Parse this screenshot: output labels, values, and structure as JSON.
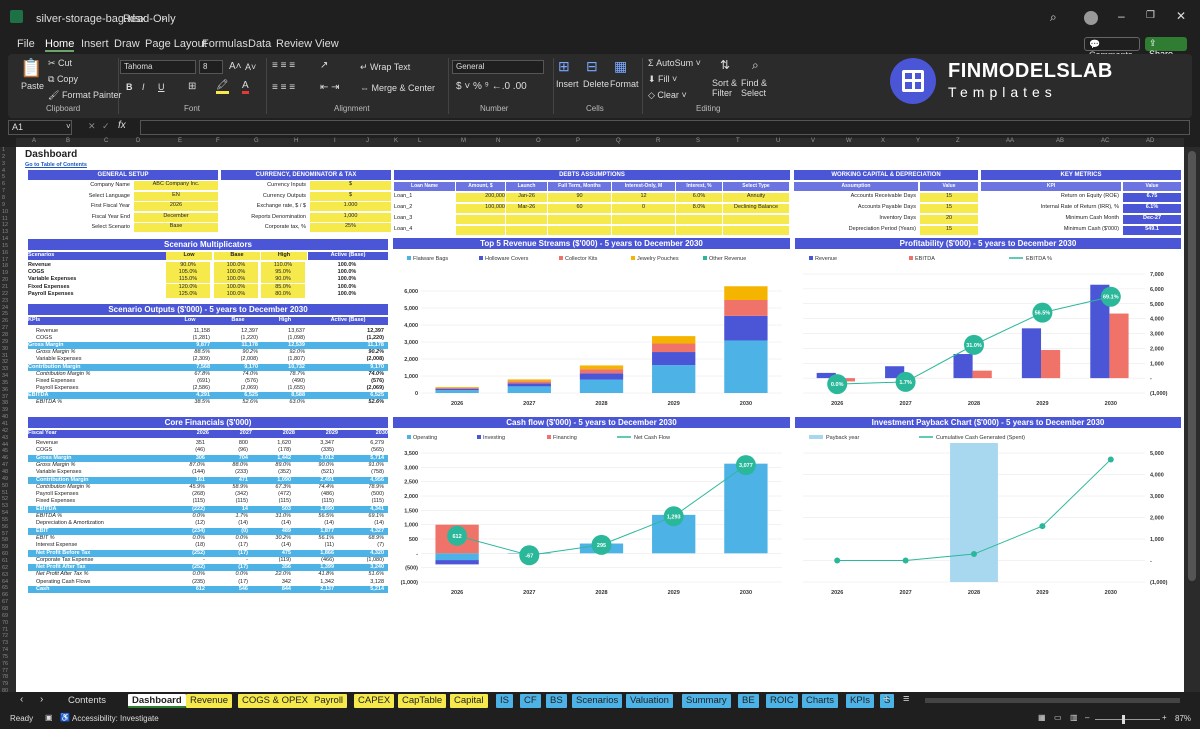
{
  "window": {
    "filename": "silver-storage-bag.xlsx",
    "mode": "Read-Only"
  },
  "menu": [
    "File",
    "Home",
    "Insert",
    "Draw",
    "Page Layout",
    "Formulas",
    "Data",
    "Review",
    "View"
  ],
  "comments_label": "Comments",
  "share_label": "Share",
  "ribbon": {
    "paste": "Paste",
    "cut": "Cut",
    "copy": "Copy",
    "format_painter": "Format Painter",
    "clipboard": "Clipboard",
    "font_name": "Tahoma",
    "font_size": "8",
    "font": "Font",
    "wrap_text": "Wrap Text",
    "merge_center": "Merge & Center",
    "alignment": "Alignment",
    "number_format": "General",
    "number": "Number",
    "insert": "Insert",
    "delete": "Delete",
    "format": "Format",
    "cells": "Cells",
    "autosum": "AutoSum",
    "fill": "Fill",
    "clear": "Clear",
    "sort_filter": "Sort & Filter",
    "find_select": "Find & Select",
    "editing": "Editing",
    "logo_top": "FINMODELSLAB",
    "logo_bottom": "Templates"
  },
  "namebox": "A1",
  "columns": [
    "A",
    "B",
    "C",
    "D",
    "E",
    "F",
    "G",
    "H",
    "I",
    "J",
    "K",
    "L",
    "M",
    "N",
    "O",
    "P",
    "Q",
    "R",
    "S",
    "T",
    "U",
    "V",
    "W",
    "X",
    "Y",
    "Z",
    "AA",
    "AB",
    "AC",
    "AD"
  ],
  "sheet": {
    "title": "Dashboard",
    "toc": "Go to Table of Contents",
    "general": {
      "header": "GENERAL SETUP",
      "rows": [
        [
          "Company Name",
          "ABC Company Inc."
        ],
        [
          "Select Language",
          "EN"
        ],
        [
          "First Fiscal Year",
          "2026"
        ],
        [
          "Fiscal Year End",
          "December"
        ],
        [
          "Select Scenario",
          "Base"
        ]
      ]
    },
    "currency": {
      "header": "CURRENCY, DENOMINATOR & TAX",
      "rows": [
        [
          "Currency Inputs",
          "$"
        ],
        [
          "Currency Outputs",
          "$"
        ],
        [
          "Exchange rate, $ / $",
          "1.000"
        ],
        [
          "Reports Denomination",
          "1,000"
        ],
        [
          "Corporate tax, %",
          "25%"
        ]
      ]
    },
    "debts": {
      "header": "DEBTS ASSUMPTIONS",
      "cols": [
        "Loan Name",
        "Amount, $",
        "Launch",
        "Full Term, Months",
        "Interest-Only, M",
        "Interest, %",
        "Select Type"
      ],
      "rows": [
        [
          "Loan_1",
          "200,000",
          "Jan-26",
          "90",
          "12",
          "6.0%",
          "Annuity"
        ],
        [
          "Loan_2",
          "100,000",
          "Mar-26",
          "60",
          "0",
          "8.0%",
          "Declining Balance"
        ],
        [
          "Loan_3",
          "",
          "",
          "",
          "",
          "",
          ""
        ],
        [
          "Loan_4",
          "",
          "",
          "",
          "",
          "",
          ""
        ]
      ]
    },
    "wc": {
      "header": "WORKING CAPITAL & DEPRECIATION",
      "cols": [
        "Assumption",
        "Value"
      ],
      "rows": [
        [
          "Accounts Receivable Days",
          "15"
        ],
        [
          "Accounts Payable Days",
          "15"
        ],
        [
          "Inventory Days",
          "20"
        ],
        [
          "Depreciation Period (Years)",
          "15"
        ]
      ]
    },
    "km": {
      "header": "KEY METRICS",
      "cols": [
        "KPI",
        "Value"
      ],
      "rows": [
        [
          "Return on Equity (ROE)",
          "6.75"
        ],
        [
          "Internal Rate of Return (IRR), %",
          "6.1%"
        ],
        [
          "Minimum Cash Month",
          "Dec-27"
        ],
        [
          "Minimum Cash ($'000)",
          "549.1"
        ]
      ]
    },
    "multipliers": {
      "header": "Scenario Multiplicators",
      "cols": [
        "Scenarios",
        "Low",
        "Base",
        "High",
        "Active (Base)"
      ],
      "rows": [
        [
          "Revenue",
          "90.0%",
          "100.0%",
          "110.0%",
          "100.0%"
        ],
        [
          "COGS",
          "105.0%",
          "100.0%",
          "95.0%",
          "100.0%"
        ],
        [
          "Variable Expenses",
          "115.0%",
          "100.0%",
          "90.0%",
          "100.0%"
        ],
        [
          "Fixed Expenses",
          "120.0%",
          "100.0%",
          "85.0%",
          "100.0%"
        ],
        [
          "Payroll Expenses",
          "125.0%",
          "100.0%",
          "80.0%",
          "100.0%"
        ]
      ]
    },
    "outputs": {
      "header": "Scenario Outputs ($'000) - 5 years to December 2030",
      "cols": [
        "KPIs",
        "Low",
        "Base",
        "High",
        "Active (Base)"
      ],
      "rows": [
        [
          "Revenue",
          "11,158",
          "12,397",
          "13,637",
          "12,397",
          ""
        ],
        [
          "COGS",
          "(1,281)",
          "(1,220)",
          "(1,098)",
          "(1,220)",
          ""
        ],
        [
          "Gross Margin",
          "9,877",
          "11,178",
          "12,539",
          "11,178",
          "hl"
        ],
        [
          "Gross Margin %",
          "88.5%",
          "90.2%",
          "92.0%",
          "90.2%",
          "it"
        ],
        [
          "Variable Expenses",
          "(2,309)",
          "(2,008)",
          "(1,807)",
          "(2,008)",
          ""
        ],
        [
          "Contribution Margin",
          "7,568",
          "9,170",
          "10,732",
          "9,170",
          "hl"
        ],
        [
          "Contribution Margin %",
          "67.8%",
          "74.0%",
          "78.7%",
          "74.0%",
          "it"
        ],
        [
          "Fixed Expenses",
          "(691)",
          "(576)",
          "(490)",
          "(576)",
          ""
        ],
        [
          "Payroll Expenses",
          "(2,586)",
          "(2,069)",
          "(1,655)",
          "(2,069)",
          ""
        ],
        [
          "EBITDA",
          "4,291",
          "6,525",
          "8,588",
          "6,525",
          "hl"
        ],
        [
          "EBITDA %",
          "38.5%",
          "52.6%",
          "63.0%",
          "52.6%",
          "it"
        ]
      ]
    },
    "core": {
      "header": "Core Financials ($'000)",
      "cols": [
        "Fiscal Year",
        "2026",
        "2027",
        "2028",
        "2029",
        "2030"
      ],
      "rows": [
        [
          "Revenue",
          "351",
          "800",
          "1,620",
          "3,347",
          "6,279",
          ""
        ],
        [
          "COGS",
          "(46)",
          "(96)",
          "(178)",
          "(335)",
          "(565)",
          ""
        ],
        [
          "Gross Margin",
          "306",
          "704",
          "1,442",
          "3,012",
          "5,714",
          "hl"
        ],
        [
          "Gross Margin %",
          "87.0%",
          "88.0%",
          "89.0%",
          "90.0%",
          "91.0%",
          "it"
        ],
        [
          "Variable Expenses",
          "(144)",
          "(233)",
          "(352)",
          "(521)",
          "(758)",
          ""
        ],
        [
          "Contribution Margin",
          "161",
          "471",
          "1,090",
          "2,491",
          "4,956",
          "hl"
        ],
        [
          "Contribution Margin %",
          "45.9%",
          "58.9%",
          "67.3%",
          "74.4%",
          "78.9%",
          "it"
        ],
        [
          "Payroll Expenses",
          "(268)",
          "(342)",
          "(472)",
          "(486)",
          "(500)",
          ""
        ],
        [
          "Fixed Expenses",
          "(115)",
          "(115)",
          "(115)",
          "(115)",
          "(115)",
          ""
        ],
        [
          "EBITDA",
          "(222)",
          "14",
          "503",
          "1,890",
          "4,341",
          "hl"
        ],
        [
          "EBITDA %",
          "0.0%",
          "1.7%",
          "31.0%",
          "56.5%",
          "69.1%",
          "it"
        ],
        [
          "Depreciation & Amortization",
          "(12)",
          "(14)",
          "(14)",
          "(14)",
          "(14)",
          ""
        ],
        [
          "EBIT",
          "(234)",
          "(0)",
          "489",
          "1,877",
          "4,327",
          "hl"
        ],
        [
          "EBIT %",
          "0.0%",
          "0.0%",
          "30.2%",
          "56.1%",
          "68.9%",
          "it"
        ],
        [
          "Interest Expense",
          "(18)",
          "(17)",
          "(14)",
          "(11)",
          "(7)",
          ""
        ],
        [
          "Net Profit Before Tax",
          "(252)",
          "(17)",
          "475",
          "1,866",
          "4,320",
          "hl"
        ],
        [
          "Corporate Tax Expense",
          "-",
          "-",
          "(119)",
          "(466)",
          "(1,080)",
          ""
        ],
        [
          "Net Profit After Tax",
          "(252)",
          "(17)",
          "356",
          "1,399",
          "3,240",
          "hl"
        ],
        [
          "Net Profit After Tax %",
          "0.0%",
          "0.0%",
          "22.0%",
          "41.8%",
          "51.6%",
          "it"
        ],
        [
          "Operating Cash Flows",
          "(235)",
          "(17)",
          "342",
          "1,342",
          "3,128",
          ""
        ],
        [
          "Cash",
          "612",
          "546",
          "844",
          "2,137",
          "5,214",
          "hl"
        ]
      ]
    }
  },
  "chart_data": [
    {
      "type": "bar",
      "title": "Top 5 Revenue Streams ($'000) - 5 years to December 2030",
      "categories": [
        "2026",
        "2027",
        "2028",
        "2029",
        "2030"
      ],
      "series": [
        {
          "name": "Flatware Bags",
          "values": [
            170,
            390,
            790,
            1640,
            3090
          ],
          "color": "#4db3e6"
        },
        {
          "name": "Holloware Covers",
          "values": [
            80,
            180,
            370,
            770,
            1450
          ],
          "color": "#4a56d6"
        },
        {
          "name": "Collector Kits",
          "values": [
            50,
            120,
            240,
            500,
            930
          ],
          "color": "#f0736a"
        },
        {
          "name": "Jewelry Pouches",
          "values": [
            50,
            110,
            220,
            437,
            809
          ],
          "color": "#f5b400"
        },
        {
          "name": "Other Revenue",
          "values": [
            0,
            0,
            0,
            0,
            0
          ],
          "color": "#2bb89a"
        }
      ],
      "ylim": [
        0,
        7000
      ],
      "yticks": [
        "0",
        "1,000",
        "2,000",
        "3,000",
        "4,000",
        "5,000",
        "6,000"
      ]
    },
    {
      "type": "bar",
      "title": "Profitability ($'000) - 5 years to December 2030",
      "categories": [
        "2026",
        "2027",
        "2028",
        "2029",
        "2030"
      ],
      "series": [
        {
          "name": "Revenue",
          "values": [
            351,
            800,
            1620,
            3347,
            6279
          ],
          "color": "#4a56d6"
        },
        {
          "name": "EBITDA",
          "values": [
            -222,
            14,
            503,
            1890,
            4341
          ],
          "color": "#f0736a"
        },
        {
          "name": "EBITDA %",
          "values": [
            0.0,
            1.7,
            31.0,
            56.5,
            69.1
          ],
          "labels": [
            "0.0%",
            "1.7%",
            "31.0%",
            "56.5%",
            "69.1%"
          ],
          "color": "#2bb89a"
        }
      ],
      "ylim": [
        -1000,
        7000
      ],
      "yticks": [
        "(1,000)",
        "-",
        "1,000",
        "2,000",
        "3,000",
        "4,000",
        "5,000",
        "6,000",
        "7,000"
      ]
    },
    {
      "type": "bar",
      "title": "Cash flow ($'000) - 5 years to December 2030",
      "categories": [
        "2026",
        "2027",
        "2028",
        "2029",
        "2030"
      ],
      "series": [
        {
          "name": "Operating",
          "values": [
            -235,
            -17,
            342,
            1342,
            3128
          ],
          "color": "#4db3e6"
        },
        {
          "name": "Investing",
          "values": [
            -150,
            0,
            0,
            0,
            0
          ],
          "color": "#4a56d6"
        },
        {
          "name": "Financing",
          "values": [
            1000,
            0,
            0,
            0,
            0
          ],
          "color": "#f0736a"
        },
        {
          "name": "Net Cash Flow",
          "values": [
            612,
            -67,
            295,
            1293,
            3077
          ],
          "labels": [
            "612",
            "-67",
            "295",
            "1,293",
            "3,077"
          ],
          "color": "#2bb89a"
        }
      ],
      "ylim": [
        -1000,
        3500
      ],
      "yticks": [
        "(1,000)",
        "(500)",
        "-",
        "500",
        "1,000",
        "1,500",
        "2,000",
        "2,500",
        "3,000",
        "3,500"
      ]
    },
    {
      "type": "line",
      "title": "Investment Payback Chart ($'000) - 5 years to December 2030",
      "categories": [
        "2026",
        "2027",
        "2028",
        "2029",
        "2030"
      ],
      "series": [
        {
          "name": "Payback year",
          "values": [
            0,
            0,
            1,
            0,
            0
          ],
          "color": "#a8d8f0"
        },
        {
          "name": "Cumulative Cash Generated (Spent)",
          "values": [
            0,
            0,
            300,
            1600,
            4700
          ],
          "color": "#2bb89a"
        }
      ],
      "ylim": [
        -1000,
        5000
      ],
      "yticks": [
        "(1,000)",
        "-",
        "1,000",
        "2,000",
        "3,000",
        "4,000",
        "5,000"
      ]
    }
  ],
  "tabs": [
    {
      "label": "Contents",
      "c": "#1f1f1f",
      "fg": "#ddd"
    },
    {
      "label": "Dashboard",
      "c": "#fff",
      "fg": "#222",
      "active": true
    },
    {
      "label": "Revenue",
      "c": "#f5e94c"
    },
    {
      "label": "COGS & OPEX",
      "c": "#f5e94c"
    },
    {
      "label": "Payroll",
      "c": "#f5e94c"
    },
    {
      "label": "CAPEX",
      "c": "#f5e94c"
    },
    {
      "label": "CapTable",
      "c": "#f5e94c"
    },
    {
      "label": "Capital",
      "c": "#f5e94c"
    },
    {
      "label": "IS",
      "c": "#4db3e6"
    },
    {
      "label": "CF",
      "c": "#4db3e6"
    },
    {
      "label": "BS",
      "c": "#4db3e6"
    },
    {
      "label": "Scenarios",
      "c": "#4db3e6"
    },
    {
      "label": "Valuation",
      "c": "#4db3e6"
    },
    {
      "label": "Summary",
      "c": "#4db3e6"
    },
    {
      "label": "BE",
      "c": "#4db3e6"
    },
    {
      "label": "ROIC",
      "c": "#4db3e6"
    },
    {
      "label": "Charts",
      "c": "#4db3e6"
    },
    {
      "label": "KPIs",
      "c": "#4db3e6"
    },
    {
      "label": "S",
      "c": "#4db3e6"
    }
  ],
  "status": {
    "ready": "Ready",
    "accessibility": "Accessibility: Investigate",
    "zoom": "87%"
  }
}
